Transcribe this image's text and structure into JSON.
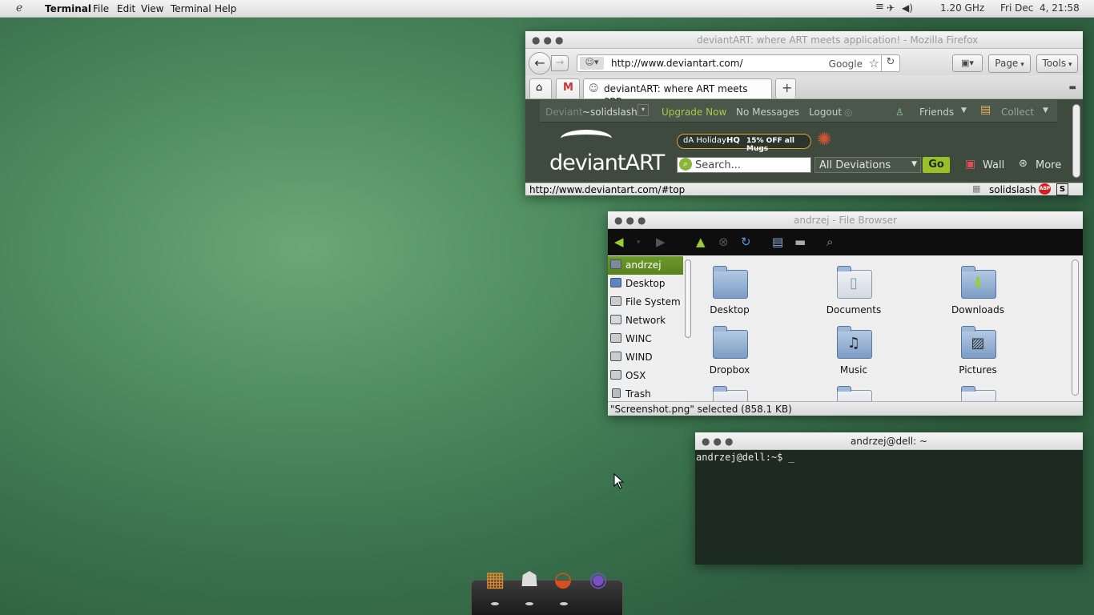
{
  "panel": {
    "app_name": "Terminal",
    "menus": [
      "File",
      "Edit",
      "View",
      "Terminal",
      "Help"
    ],
    "cpu": "1.20 GHz",
    "clock": "Fri Dec  4, 21:58"
  },
  "firefox": {
    "title": "deviantART: where ART meets application! - Mozilla Firefox",
    "url": "http://www.deviantart.com/",
    "search_engine": "Google",
    "page_menu": "Page",
    "tools_menu": "Tools",
    "tab_title": "deviantART: where ART meets app...",
    "da_deviant": "Deviant",
    "da_user": "~solidslash",
    "da_upgrade": "Upgrade Now",
    "da_messages": "No Messages",
    "da_logout": "Logout",
    "da_friends": "Friends",
    "da_collect": "Collect",
    "da_logo": "deviantART",
    "da_promo_a": "dA Holiday",
    "da_promo_b": "HQ",
    "da_promo_c": "15% OFF all Mugs",
    "da_search_placeholder": "Search...",
    "da_scope": "All Deviations",
    "da_go": "Go",
    "da_wall": "Wall",
    "da_more": "More",
    "status_url": "http://www.deviantart.com/#top",
    "status_user": "solidslash",
    "abp": "ABP"
  },
  "filebrowser": {
    "title": "andrzej - File Browser",
    "sidebar": [
      "andrzej",
      "Desktop",
      "File System",
      "Network",
      "WINC",
      "WIND",
      "OSX",
      "Trash"
    ],
    "folders": [
      "Desktop",
      "Documents",
      "Downloads",
      "Dropbox",
      "Music",
      "Pictures"
    ],
    "status": "\"Screenshot.png\" selected (858.1 KB)"
  },
  "terminal": {
    "title": "andrzej@dell: ~",
    "prompt": "andrzej@dell:~$ _"
  },
  "colors": {
    "accent_green": "#6d9a2b",
    "desktop": "#4f8e60",
    "da_go": "#9bbf2a"
  }
}
